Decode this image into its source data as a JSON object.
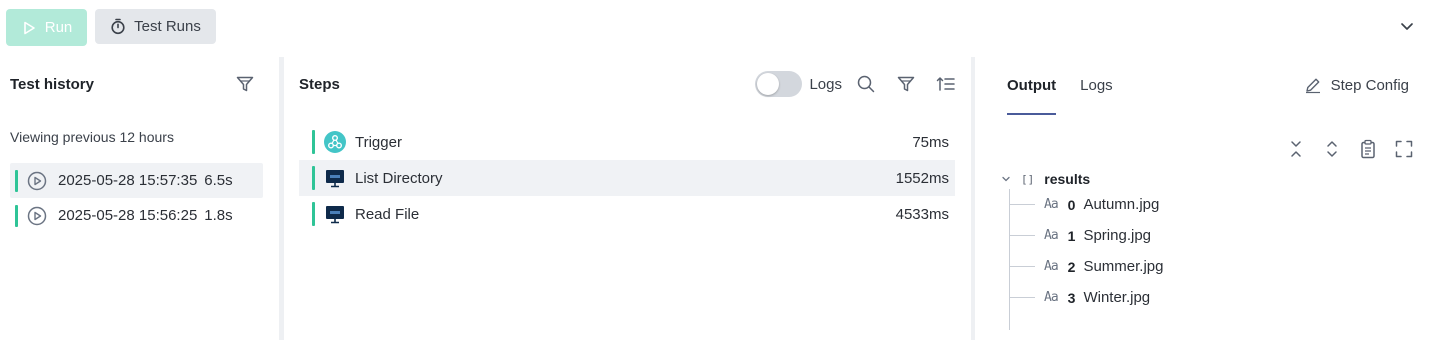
{
  "toolbar": {
    "run_label": "Run",
    "test_runs_label": "Test Runs"
  },
  "history": {
    "title": "Test history",
    "subtitle": "Viewing previous 12 hours",
    "runs": [
      {
        "timestamp": "2025-05-28 15:57:35",
        "duration": "6.5s"
      },
      {
        "timestamp": "2025-05-28 15:56:25",
        "duration": "1.8s"
      }
    ]
  },
  "steps": {
    "title": "Steps",
    "logs_toggle_label": "Logs",
    "items": [
      {
        "name": "Trigger",
        "time": "75ms"
      },
      {
        "name": "List Directory",
        "time": "1552ms"
      },
      {
        "name": "Read File",
        "time": "4533ms"
      }
    ]
  },
  "output": {
    "tabs": [
      "Output",
      "Logs"
    ],
    "step_config_label": "Step Config",
    "tree": {
      "root_type": "[]",
      "root_name": "results",
      "items": [
        {
          "type": "Aa",
          "index": "0",
          "value": "Autumn.jpg"
        },
        {
          "type": "Aa",
          "index": "1",
          "value": "Spring.jpg"
        },
        {
          "type": "Aa",
          "index": "2",
          "value": "Summer.jpg"
        },
        {
          "type": "Aa",
          "index": "3",
          "value": "Winter.jpg"
        }
      ]
    }
  },
  "colors": {
    "accent_green": "#2fc497",
    "run_button": "#b2ead9",
    "tab_underline": "#4a5b9a"
  },
  "icons": [
    "play-icon",
    "stopwatch-icon",
    "chevron-down-icon",
    "filter-icon",
    "play-circle-icon",
    "search-icon",
    "sort-icon",
    "webhook-icon",
    "sftp-icon",
    "pencil-icon",
    "collapse-all-icon",
    "expand-all-icon",
    "clipboard-icon",
    "fullscreen-icon"
  ]
}
